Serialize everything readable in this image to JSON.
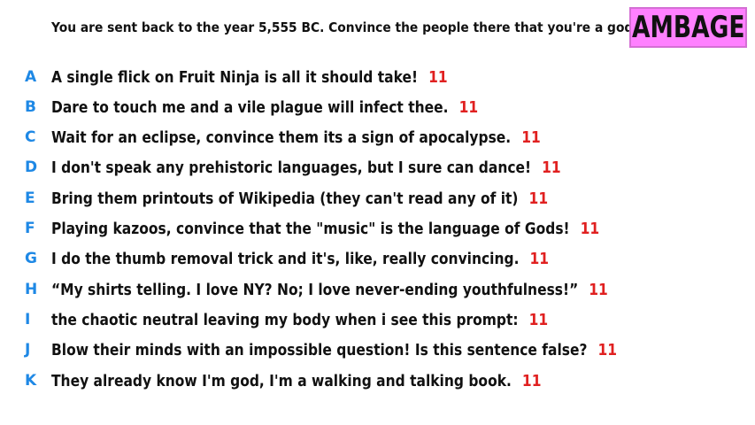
{
  "prompt": {
    "text": "You are sent back to the year 5,555 BC. Convince the people there that you're a god."
  },
  "logo": {
    "text": "AMBAGE",
    "bg_color": "#ff80ff",
    "border_color": "#d46fd4"
  },
  "colors": {
    "letter": "#1e88e5",
    "score": "#e02020",
    "text": "#111111"
  },
  "answers": [
    {
      "letter": "A",
      "text": "A single flick on Fruit Ninja is all it should take!",
      "score": "11"
    },
    {
      "letter": "B",
      "text": "Dare to touch me and a vile plague will infect thee.",
      "score": "11"
    },
    {
      "letter": "C",
      "text": "Wait for an eclipse, convince them its a sign of apocalypse.",
      "score": "11"
    },
    {
      "letter": "D",
      "text": "I don't speak any prehistoric languages, but I sure can dance!",
      "score": "11"
    },
    {
      "letter": "E",
      "text": "Bring them printouts of Wikipedia (they can't read any of it)",
      "score": "11"
    },
    {
      "letter": "F",
      "text": "Playing kazoos, convince that the \"music\" is the language of Gods!",
      "score": "11"
    },
    {
      "letter": "G",
      "text": "I do the thumb removal trick and it's, like, really convincing.",
      "score": "11"
    },
    {
      "letter": "H",
      "text": "“My shirts telling. I love NY? No; I love never-ending youthfulness!”",
      "score": "11"
    },
    {
      "letter": "I",
      "text": "the chaotic neutral leaving my body when i see this prompt:",
      "score": "11"
    },
    {
      "letter": "J",
      "text": "Blow their minds with an impossible question! Is this sentence false?",
      "score": "11"
    },
    {
      "letter": "K",
      "text": "They already know I'm god, I'm a walking and talking book.",
      "score": "11"
    }
  ]
}
